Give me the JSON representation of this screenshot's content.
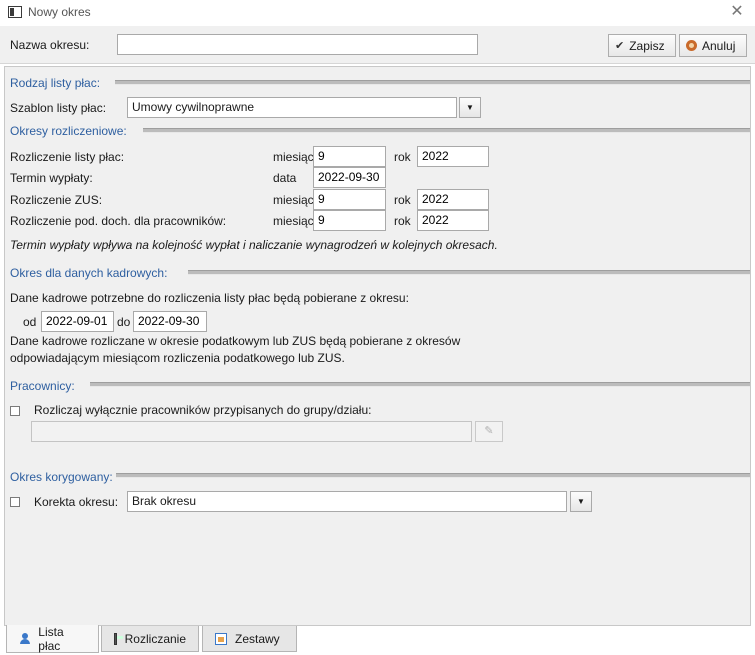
{
  "window": {
    "title": "Nowy okres",
    "close_glyph": "✕"
  },
  "header": {
    "name_label": "Nazwa okresu:",
    "name_value": "",
    "save_label": "Zapisz",
    "cancel_label": "Anuluj"
  },
  "payroll_type": {
    "section": "Rodzaj listy płac:",
    "template_label": "Szablon listy płac:",
    "template_value": "Umowy cywilnoprawne"
  },
  "settlement": {
    "section": "Okresy rozliczeniowe:",
    "rows": [
      {
        "label": "Rozliczenie listy płac:",
        "unit": "miesiąc",
        "month": "9",
        "year_label": "rok",
        "year": "2022"
      },
      {
        "label": "Termin wypłaty:",
        "unit": "data",
        "date": "2022-09-30"
      },
      {
        "label": "Rozliczenie ZUS:",
        "unit": "miesiąc",
        "month": "9",
        "year_label": "rok",
        "year": "2022"
      },
      {
        "label": "Rozliczenie pod. doch. dla pracowników:",
        "unit": "miesiąc",
        "month": "9",
        "year_label": "rok",
        "year": "2022"
      }
    ],
    "note": "Termin wypłaty wpływa na kolejność wypłat i naliczanie wynagrodzeń w kolejnych okresach."
  },
  "hr_period": {
    "section": "Okres dla danych kadrowych:",
    "info": "Dane kadrowe potrzebne do rozliczenia listy płac będą pobierane z okresu:",
    "from_label": "od",
    "from": "2022-09-01",
    "to_label": "do",
    "to": "2022-09-30",
    "note_line1": "Dane kadrowe rozliczane w okresie podatkowym lub ZUS będą pobierane z okresów",
    "note_line2": "odpowiadającym miesiącom rozliczenia podatkowego lub ZUS."
  },
  "employees": {
    "section": "Pracownicy:",
    "checkbox_label": "Rozliczaj wyłącznie pracowników przypisanych do grupy/działu:"
  },
  "correction": {
    "section": "Okres korygowany:",
    "checkbox_label": "Korekta okresu:",
    "value": "Brak okresu"
  },
  "tabs": [
    {
      "label": "Lista płac",
      "icon": "person-icon"
    },
    {
      "label": "Rozliczanie",
      "icon": "calculator-icon"
    },
    {
      "label": "Zestawy",
      "icon": "sets-icon"
    }
  ]
}
